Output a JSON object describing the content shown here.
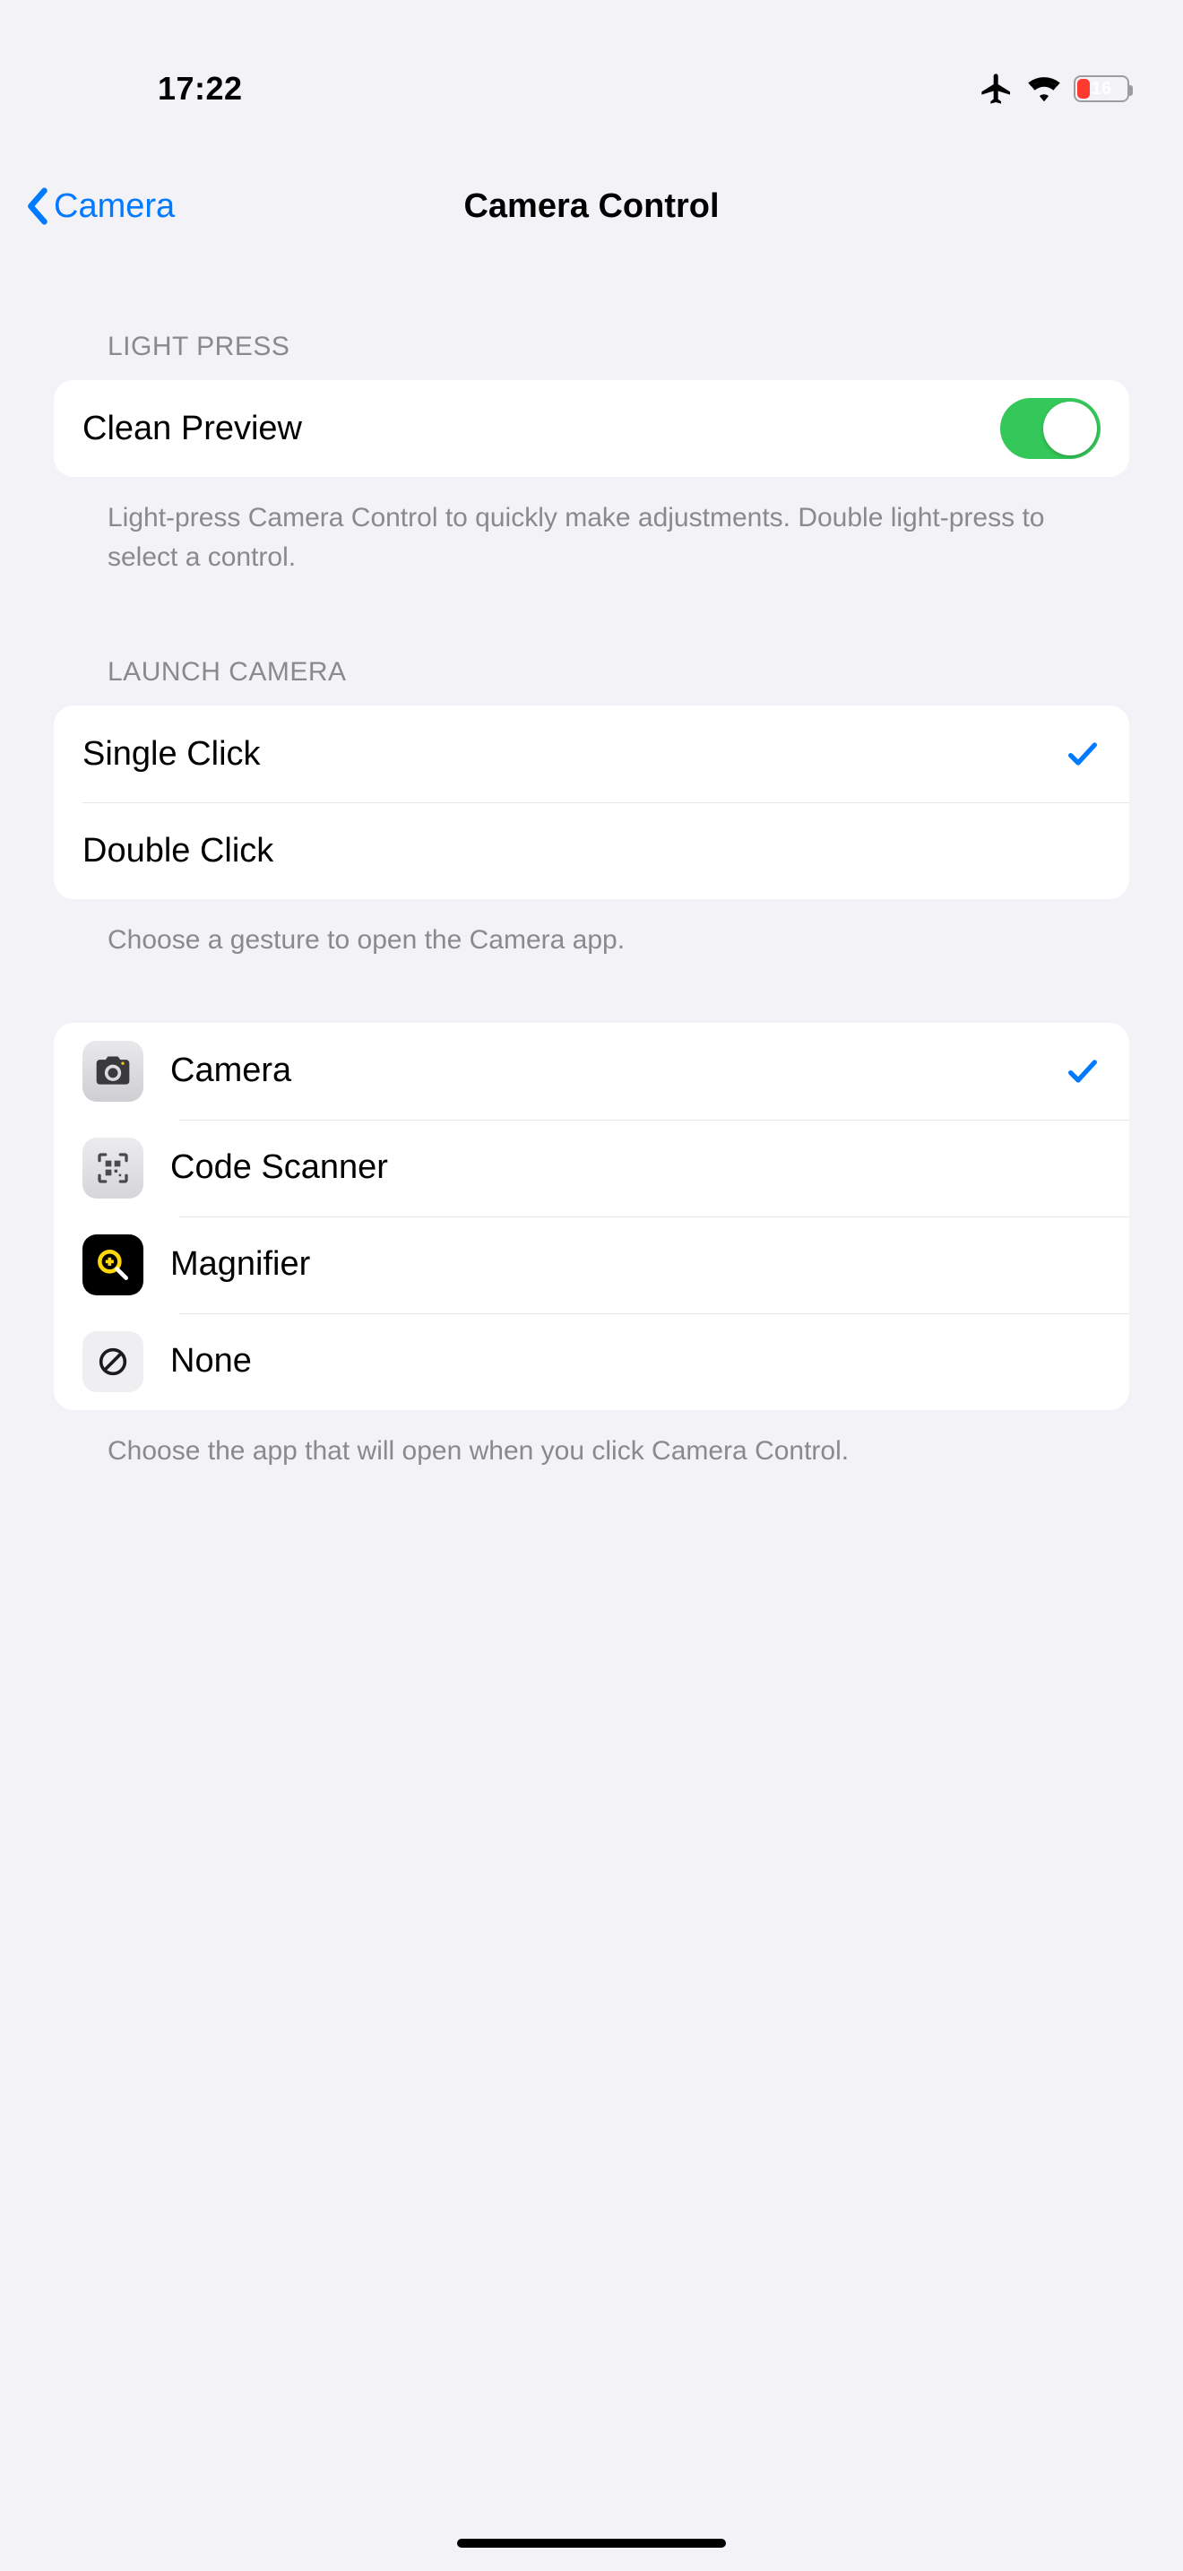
{
  "status": {
    "time": "17:22",
    "battery_pct": "16"
  },
  "nav": {
    "back_label": "Camera",
    "title": "Camera Control"
  },
  "light_press": {
    "header": "Light Press",
    "clean_preview_label": "Clean Preview",
    "clean_preview_on": true,
    "footer": "Light-press Camera Control to quickly make adjustments. Double light-press to select a control."
  },
  "launch": {
    "header": "Launch Camera",
    "options": [
      {
        "label": "Single Click",
        "selected": true
      },
      {
        "label": "Double Click",
        "selected": false
      }
    ],
    "footer": "Choose a gesture to open the Camera app."
  },
  "apps": {
    "options": [
      {
        "label": "Camera",
        "icon": "camera",
        "selected": true
      },
      {
        "label": "Code Scanner",
        "icon": "scanner",
        "selected": false
      },
      {
        "label": "Magnifier",
        "icon": "magnifier",
        "selected": false
      },
      {
        "label": "None",
        "icon": "none",
        "selected": false
      }
    ],
    "footer": "Choose the app that will open when you click Camera Control."
  }
}
